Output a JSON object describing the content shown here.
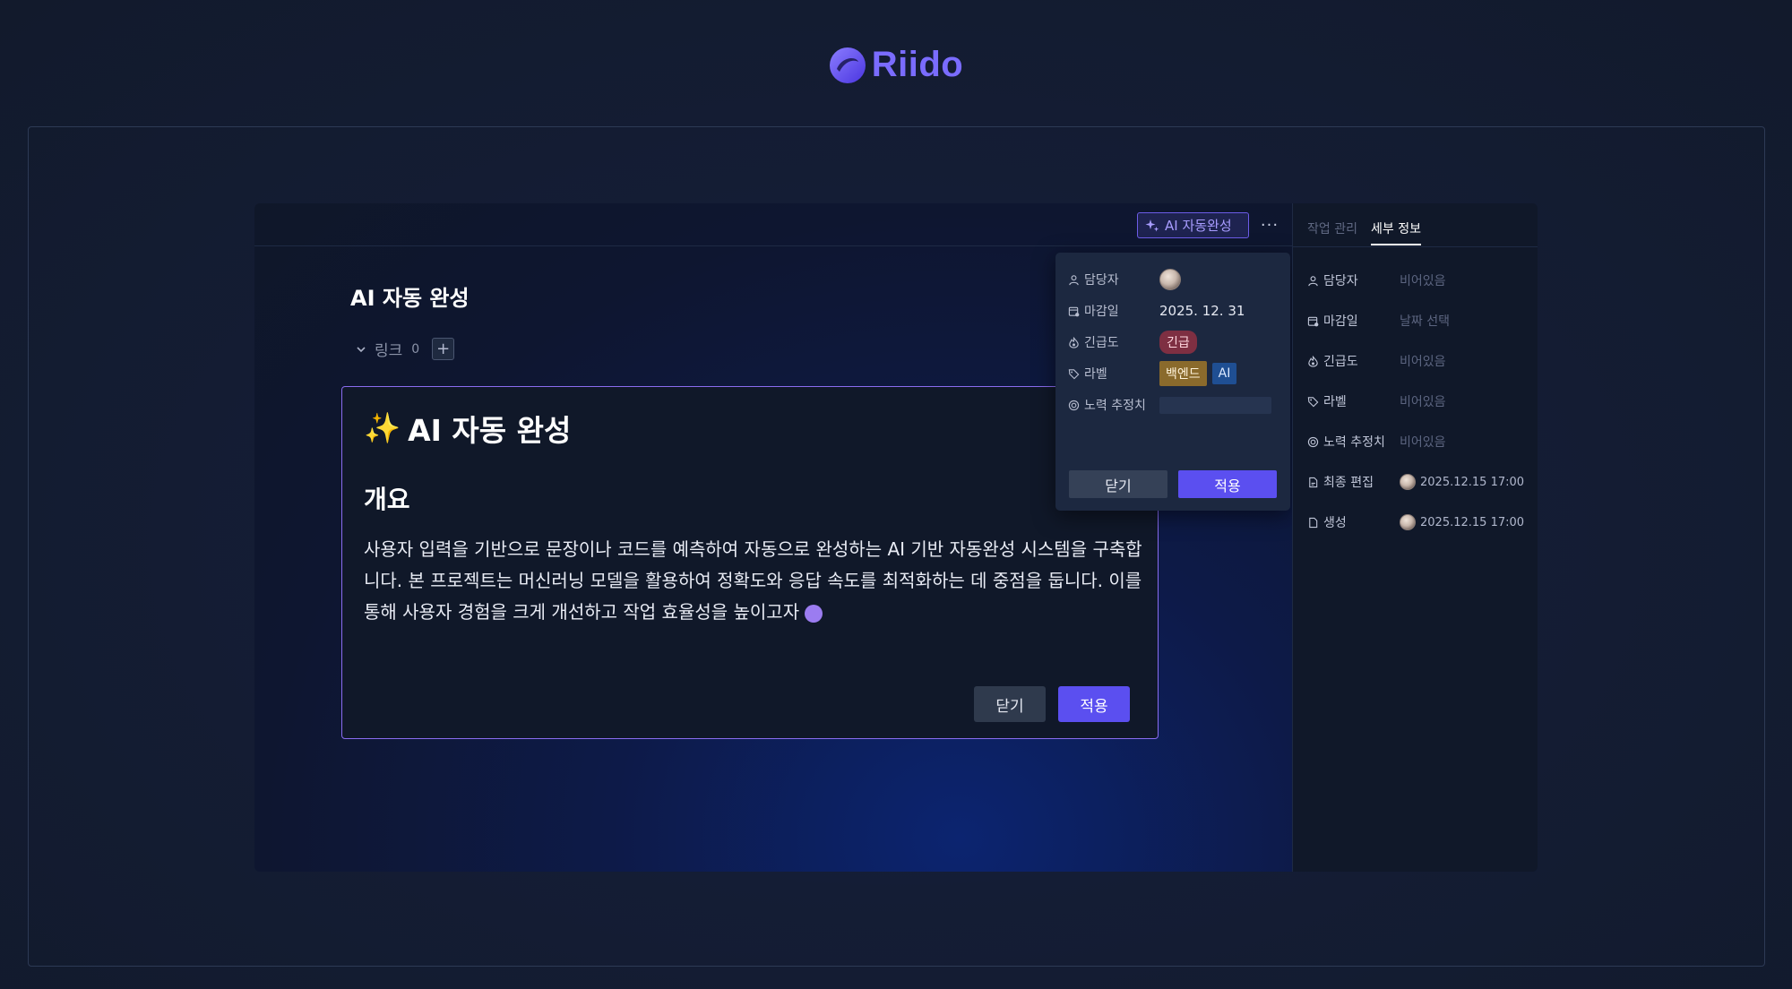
{
  "brand": {
    "name": "Riido"
  },
  "toolbar": {
    "ai_button_label": "AI 자동완성",
    "more_label": "···"
  },
  "page": {
    "title": "AI 자동 완성",
    "link_label": "링크",
    "link_count": "0",
    "add_label": "+"
  },
  "editor": {
    "emoji": "✨",
    "heading": "AI 자동 완성",
    "subheading": "개요",
    "body": "사용자 입력을 기반으로 문장이나 코드를 예측하여 자동으로 완성하는 AI 기반 자동완성 시스템을 구축합니다. 본 프로젝트는 머신러닝 모델을 활용하여 정확도와 응답 속도를 최적화하는 데 중점을 둡니다. 이를 통해 사용자 경험을 크게 개선하고 작업 효율성을 높이고자",
    "close_label": "닫기",
    "apply_label": "적용"
  },
  "popup": {
    "assignee_label": "담당자",
    "due_label": "마감일",
    "due_value": "2025. 12. 31",
    "priority_label": "긴급도",
    "priority_value": "긴급",
    "label_label": "라벨",
    "labels": [
      "백엔드",
      "AI"
    ],
    "effort_label": "노력 추정치",
    "close_label": "닫기",
    "apply_label": "적용"
  },
  "side": {
    "tabs": [
      "작업 관리",
      "세부 정보"
    ],
    "rows": [
      {
        "label": "담당자",
        "value": "비어있음"
      },
      {
        "label": "마감일",
        "value": "날짜 선택"
      },
      {
        "label": "긴급도",
        "value": "비어있음"
      },
      {
        "label": "라벨",
        "value": "비어있음"
      },
      {
        "label": "노력 추정치",
        "value": "비어있음"
      },
      {
        "label": "최종 편집",
        "value": "2025.12.15 17:00"
      },
      {
        "label": "생성",
        "value": "2025.12.15 17:00"
      }
    ]
  },
  "colors": {
    "accent": "#5b4ff0",
    "brand": "#7a6cff",
    "urgent": "#7e2f42",
    "tag_backend": "#8a6a2c",
    "tag_ai": "#1f4f93"
  }
}
